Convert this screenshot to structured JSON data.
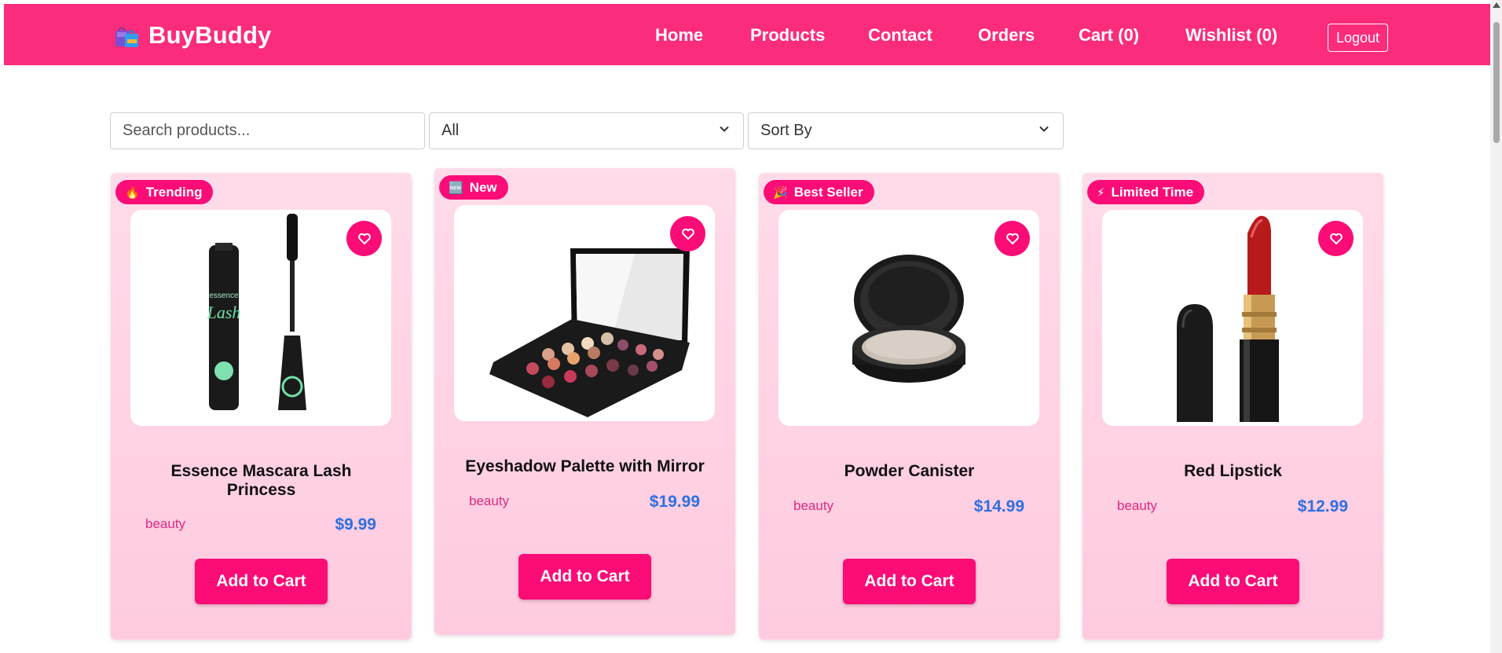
{
  "brand": {
    "name": "BuyBuddy",
    "icon": "shopping-bags-icon"
  },
  "nav": {
    "links": [
      "Home",
      "Products",
      "Contact",
      "Orders",
      "Cart (0)",
      "Wishlist (0)"
    ],
    "logout": "Logout"
  },
  "filters": {
    "search_placeholder": "Search products...",
    "category_selected": "All",
    "sort_selected": "Sort By"
  },
  "products": [
    {
      "badge": "Trending",
      "badge_icon": "🔥",
      "title_line1": "Essence Mascara Lash",
      "title_line2": "Princess",
      "category": "beauty",
      "price": "$9.99",
      "button": "Add to Cart",
      "image": "mascara-image"
    },
    {
      "badge": "New",
      "badge_icon": "🆕",
      "title_line1": "Eyeshadow Palette with Mirror",
      "title_line2": "",
      "category": "beauty",
      "price": "$19.99",
      "button": "Add to Cart",
      "image": "eyeshadow-palette-image"
    },
    {
      "badge": "Best Seller",
      "badge_icon": "🎉",
      "title_line1": "Powder Canister",
      "title_line2": "",
      "category": "beauty",
      "price": "$14.99",
      "button": "Add to Cart",
      "image": "powder-canister-image"
    },
    {
      "badge": "Limited Time",
      "badge_icon": "⚡",
      "title_line1": "Red Lipstick",
      "title_line2": "",
      "category": "beauty",
      "price": "$12.99",
      "button": "Add to Cart",
      "image": "lipstick-image"
    }
  ],
  "colors": {
    "navbar": "#fb2c7b",
    "accent": "#fb0c77",
    "price": "#2f6fe0",
    "category": "#e0297f",
    "card_bg": "#ffd3e5"
  }
}
